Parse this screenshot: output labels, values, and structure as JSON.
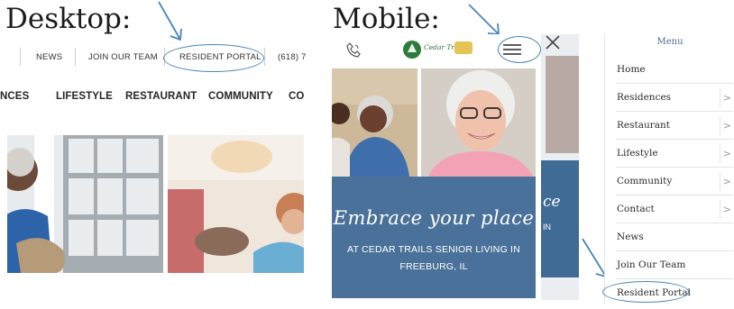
{
  "captions": {
    "desktop": "Desktop:",
    "mobile": "Mobile:"
  },
  "desktop": {
    "top_nav": {
      "news": "NEWS",
      "join": "JOIN OUR TEAM",
      "resident_portal": "RESIDENT PORTAL",
      "phone": "(618) 7"
    },
    "main_nav": [
      "NCES",
      "LIFESTYLE",
      "RESTAURANT",
      "COMMUNITY",
      "CO"
    ]
  },
  "mobile": {
    "logo_text": "Cedar Trails",
    "hero_script": "Embrace your place",
    "hero_sub": "AT CEDAR TRAILS SENIOR LIVING IN FREEBURG, IL",
    "strip_text": {
      "script": "ce",
      "sub": "IN"
    }
  },
  "menu": {
    "title": "Menu",
    "items": [
      {
        "label": "Home",
        "chevron": false
      },
      {
        "label": "Residences",
        "chevron": true
      },
      {
        "label": "Restaurant",
        "chevron": true
      },
      {
        "label": "Lifestyle",
        "chevron": true
      },
      {
        "label": "Community",
        "chevron": true
      },
      {
        "label": "Contact",
        "chevron": true
      },
      {
        "label": "News",
        "chevron": false
      },
      {
        "label": "Join Our Team",
        "chevron": false
      },
      {
        "label": "Resident Portal",
        "chevron": false
      }
    ]
  },
  "colors": {
    "annotation": "#4a86b8",
    "hero": "#4a7199",
    "menu_title": "#4b6f92"
  },
  "icons": {
    "phone": "phone-icon",
    "menu": "hamburger-menu-icon",
    "chevron": "chevron-right-icon"
  }
}
